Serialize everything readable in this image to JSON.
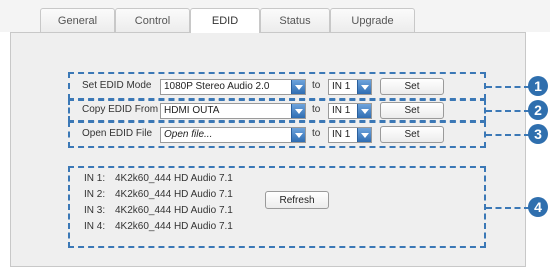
{
  "tabs": [
    {
      "label": "General",
      "active": false
    },
    {
      "label": "Control",
      "active": false
    },
    {
      "label": "EDID",
      "active": true
    },
    {
      "label": "Status",
      "active": false
    },
    {
      "label": "Upgrade",
      "active": false
    }
  ],
  "edid_rows": [
    {
      "label": "Set EDID Mode",
      "select_value": "1080P Stereo Audio 2.0",
      "to_label": "to",
      "input_value": "IN 1",
      "button": "Set"
    },
    {
      "label": "Copy EDID From",
      "select_value": "HDMI OUTA",
      "to_label": "to",
      "input_value": "IN 1",
      "button": "Set"
    },
    {
      "label": "Open EDID File",
      "select_value": "Open file...",
      "to_label": "to",
      "input_value": "IN 1",
      "button": "Set"
    }
  ],
  "status": {
    "lines": [
      {
        "port": "IN 1:",
        "value": "4K2k60_444 HD Audio 7.1"
      },
      {
        "port": "IN 2:",
        "value": "4K2k60_444 HD Audio 7.1"
      },
      {
        "port": "IN 3:",
        "value": "4K2k60_444 HD Audio 7.1"
      },
      {
        "port": "IN 4:",
        "value": "4K2k60_444 HD Audio 7.1"
      }
    ],
    "refresh_button": "Refresh"
  },
  "callouts": [
    "1",
    "2",
    "3",
    "4"
  ],
  "colors": {
    "accent": "#2f6fae",
    "dash": "#3b78b6",
    "panel": "#efefef"
  }
}
